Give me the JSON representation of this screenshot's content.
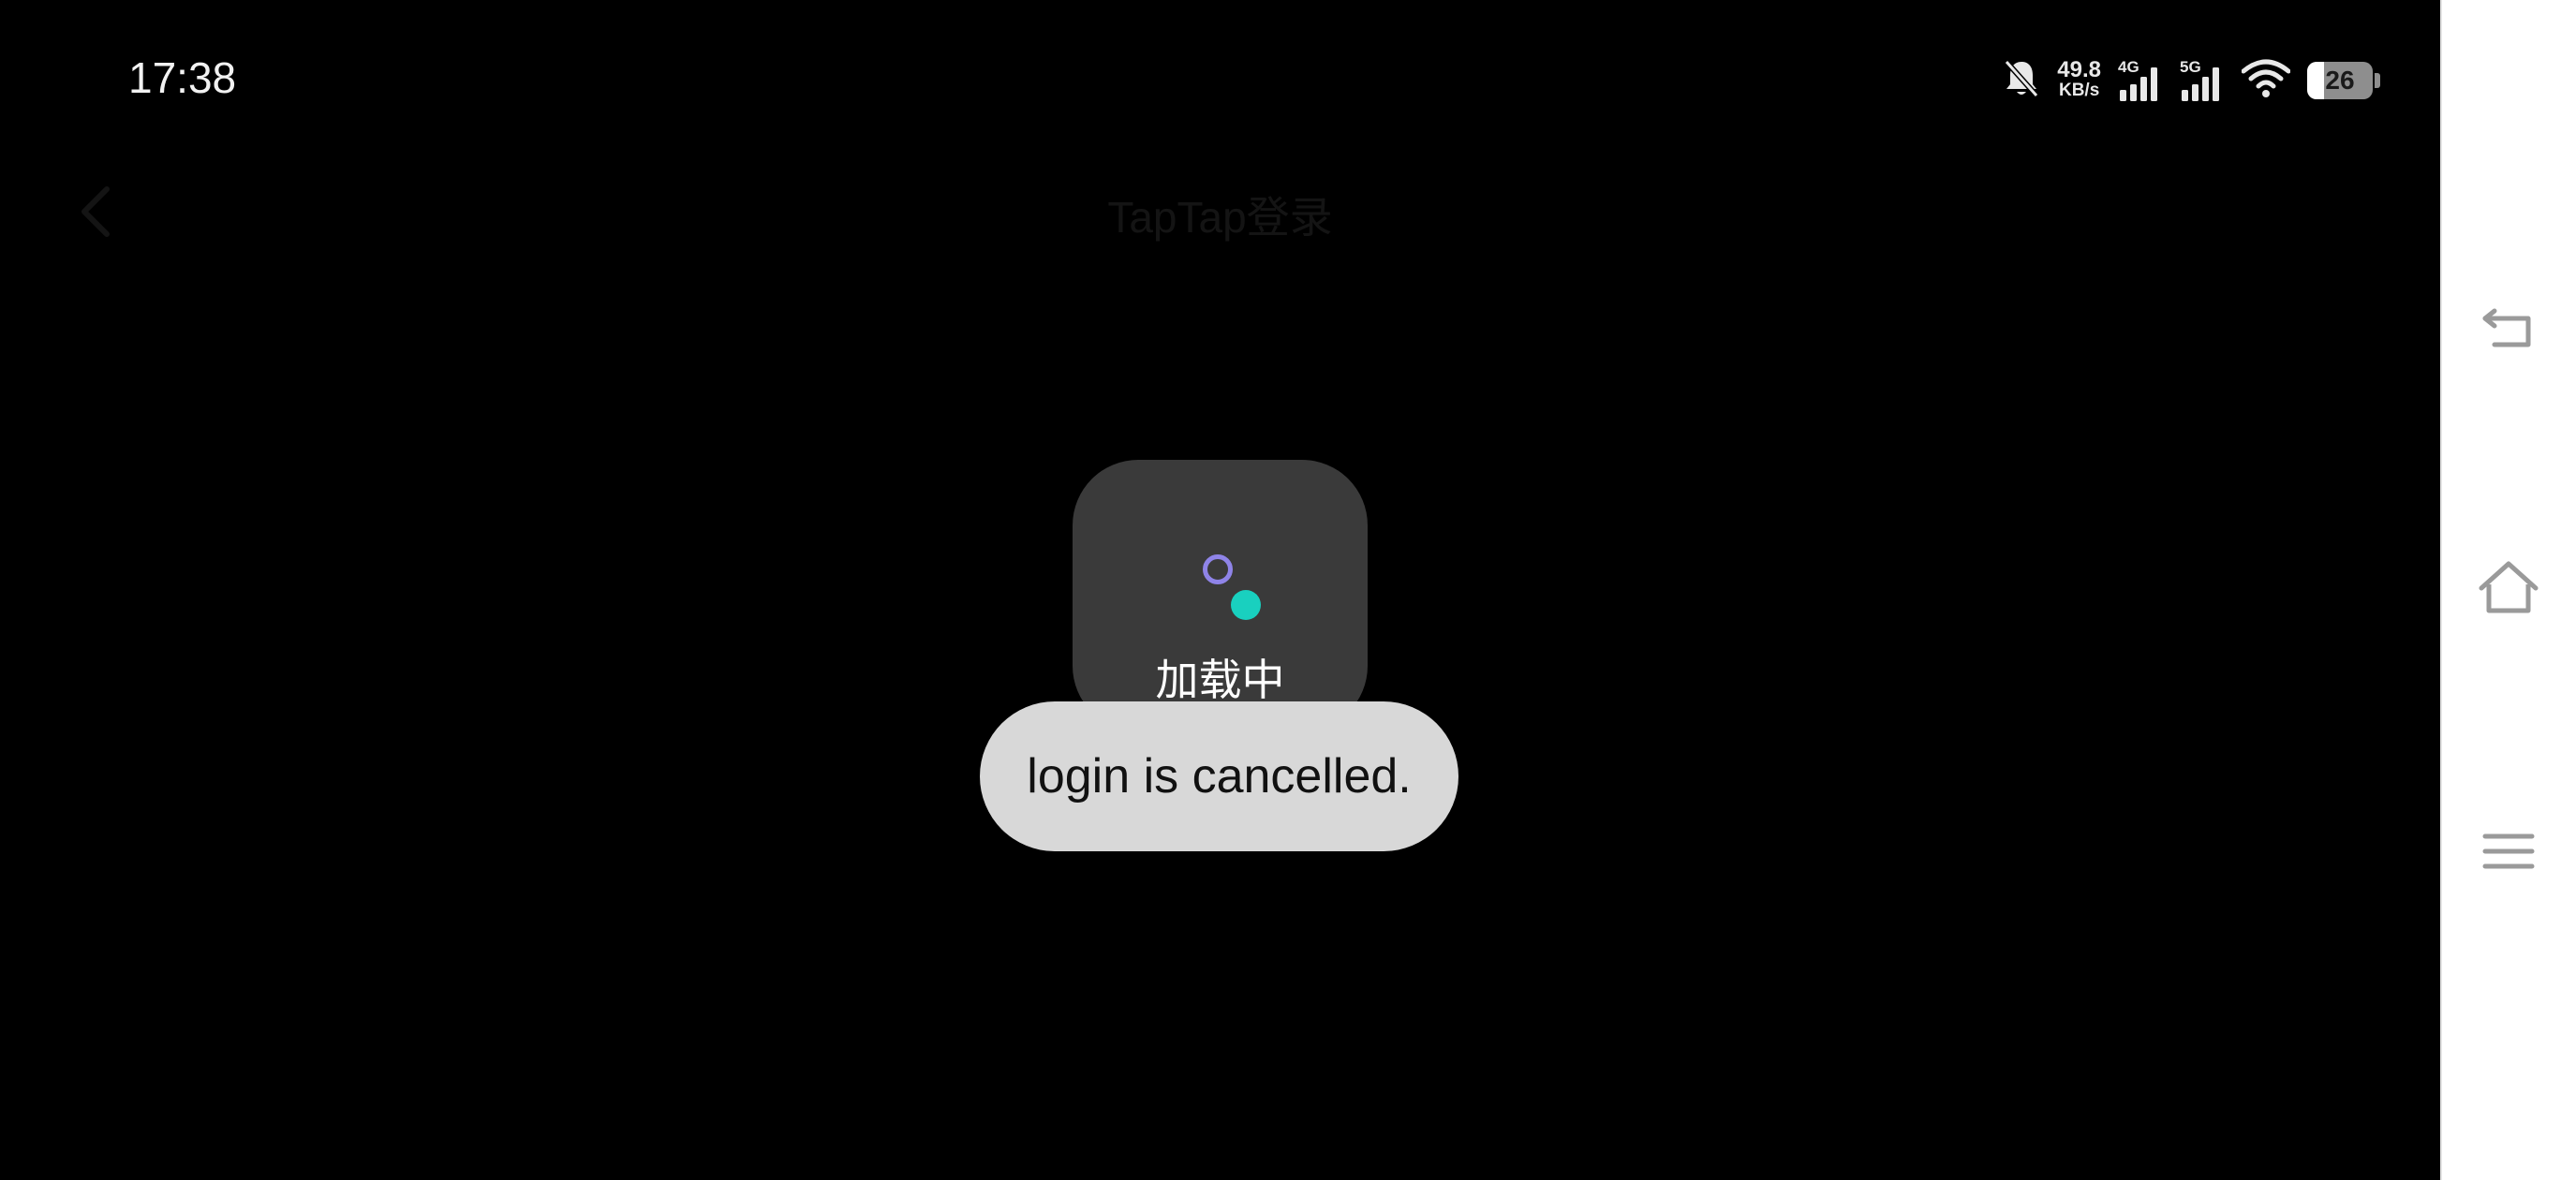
{
  "status_bar": {
    "time": "17:38",
    "net_speed_value": "49.8",
    "net_speed_unit": "KB/s",
    "sim1_label": "4G",
    "sim2_label": "5G",
    "battery_level": 26,
    "battery_text": "26"
  },
  "header": {
    "title": "TapTap登录"
  },
  "loading": {
    "label": "加载中"
  },
  "toast": {
    "message": "login is cancelled."
  },
  "colors": {
    "loading_ring": "#8f84e8",
    "loading_dot": "#19d0bf",
    "toast_bg": "#d8d8d8"
  },
  "nav_bar": {
    "icons": [
      "back-icon",
      "home-icon",
      "menu-icon"
    ]
  }
}
